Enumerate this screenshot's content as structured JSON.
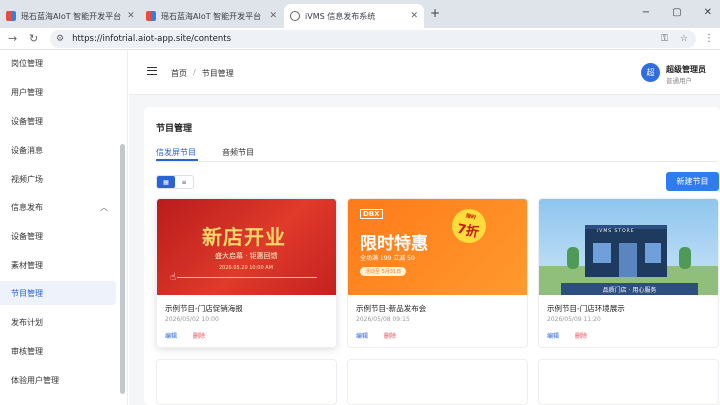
{
  "browser": {
    "tabs": [
      {
        "title": "瑶石蓝海AIoT 智能开发平台",
        "active": false
      },
      {
        "title": "瑶石蓝海AIoT 智能开发平台",
        "active": false
      },
      {
        "title": "iVMS 信息发布系统",
        "active": true
      }
    ],
    "new_tab": "+",
    "url": "https://infotrial.aiot-app.site/contents",
    "win_min": "−",
    "win_max": "▢",
    "win_close": "✕"
  },
  "sidebar": {
    "items": [
      {
        "label": "岗位管理",
        "active": false
      },
      {
        "label": "用户管理",
        "active": false
      },
      {
        "label": "设备管理",
        "active": false
      },
      {
        "label": "设备消息",
        "active": false
      },
      {
        "label": "视频广场",
        "active": false
      },
      {
        "label": "信息发布",
        "active": false,
        "expandable": true
      },
      {
        "label": "设备管理",
        "active": false
      },
      {
        "label": "素材管理",
        "active": false
      },
      {
        "label": "节目管理",
        "active": true
      },
      {
        "label": "发布计划",
        "active": false
      },
      {
        "label": "审核管理",
        "active": false
      },
      {
        "label": "体验用户管理",
        "active": false
      }
    ]
  },
  "header": {
    "breadcrumb": [
      "首页",
      "节目管理"
    ],
    "breadcrumb_sep": "/",
    "avatar_char": "超",
    "user_name": "超级管理员",
    "user_role": "普通用户"
  },
  "panel": {
    "title": "节目管理",
    "tabs": [
      {
        "label": "信发屏节目",
        "active": true
      },
      {
        "label": "音频节目",
        "active": false
      }
    ],
    "view_toggle": {
      "grid": "▦",
      "list": "≡",
      "selected": "grid"
    },
    "new_button": "新建节目",
    "edit_label": "编辑",
    "delete_label": "删除",
    "cards": [
      {
        "title": "示例节目-门店促销海报",
        "date": "2026/05/02 10:00",
        "thumb": {
          "headline": "新店开业",
          "sub": "盛大启幕 · 钜惠回馈",
          "date": "2026.05.20 10:00 AM"
        }
      },
      {
        "title": "示例节目-新品发布会",
        "date": "2026/05/08 09:15",
        "thumb": {
          "logo": "DBX",
          "headline": "限时特惠",
          "line": "全场满 199 立减 50",
          "pill": "活动至 5月31日",
          "badge_top": "限时",
          "badge_main": "7折"
        }
      },
      {
        "title": "示例节目-门店环境展示",
        "date": "2026/05/09 11:20",
        "thumb": {
          "sign": "iVMS STORE",
          "banner": "品质门店 · 用心服务"
        }
      }
    ]
  }
}
